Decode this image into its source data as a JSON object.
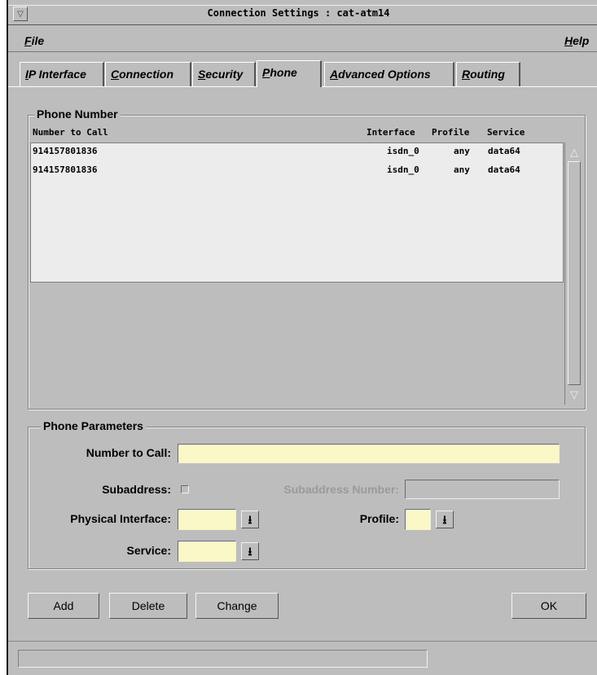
{
  "window": {
    "title": "Connection Settings : cat-atm14",
    "sys_icon": "▽"
  },
  "menubar": {
    "file": {
      "key": "F",
      "rest": "ile"
    },
    "help": {
      "key": "H",
      "rest": "elp"
    }
  },
  "tabs": [
    {
      "key": "I",
      "rest": "P Interface",
      "active": false
    },
    {
      "key": "C",
      "rest": "onnection",
      "active": false
    },
    {
      "key": "S",
      "rest": "ecurity",
      "active": false
    },
    {
      "key": "P",
      "rest": "hone",
      "active": true
    },
    {
      "key": "A",
      "rest": "dvanced Options",
      "active": false
    },
    {
      "key": "R",
      "rest": "outing",
      "active": false
    }
  ],
  "phone_number": {
    "legend": "Phone Number",
    "columns": {
      "number": "Number to Call",
      "interface": "Interface",
      "profile": "Profile",
      "service": "Service"
    },
    "rows": [
      {
        "number": "914157801836",
        "interface": "isdn_0",
        "profile": "any",
        "service": "data64"
      },
      {
        "number": "914157801836",
        "interface": "isdn_0",
        "profile": "any",
        "service": "data64"
      }
    ],
    "scroll_up": "△",
    "scroll_down": "▽"
  },
  "phone_parameters": {
    "legend": "Phone Parameters",
    "number_to_call_label": "Number to Call:",
    "number_to_call_value": "",
    "subaddress_label": "Subaddress:",
    "subaddress_number_label": "Subaddress Number:",
    "physical_interface_label": "Physical Interface:",
    "profile_label": "Profile:",
    "service_label": "Service:",
    "combo_arrow": "⭳"
  },
  "buttons": {
    "add": "Add",
    "delete": "Delete",
    "change": "Change",
    "ok": "OK"
  }
}
